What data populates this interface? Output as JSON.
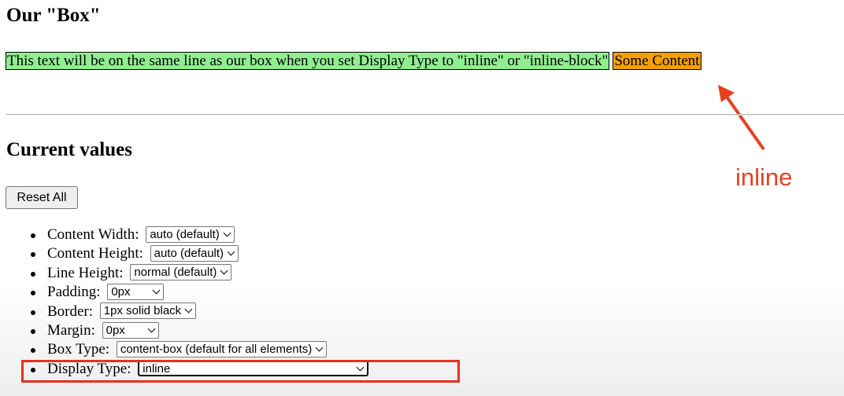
{
  "page": {
    "title": "Our \"Box\"",
    "demo_text": "This text will be on the same line as our box when you set Display Type to \"inline\" or \"inline-block\"",
    "box_content": "Some Content",
    "current_values_heading": "Current values",
    "reset_label": "Reset All",
    "annotation": "inline"
  },
  "colors": {
    "demo_text_bg": "#90ee90",
    "box_bg": "#f5a000",
    "annotation": "#e8411e",
    "highlight": "#e8311a"
  },
  "properties": [
    {
      "label": "Content Width:",
      "value": "auto (default)"
    },
    {
      "label": "Content Height:",
      "value": "auto (default)"
    },
    {
      "label": "Line Height:",
      "value": "normal (default)"
    },
    {
      "label": "Padding:",
      "value": "0px"
    },
    {
      "label": "Border:",
      "value": "1px solid black"
    },
    {
      "label": "Margin:",
      "value": "0px"
    },
    {
      "label": "Box Type:",
      "value": "content-box (default for all elements)"
    },
    {
      "label": "Display Type:",
      "value": "inline"
    }
  ]
}
